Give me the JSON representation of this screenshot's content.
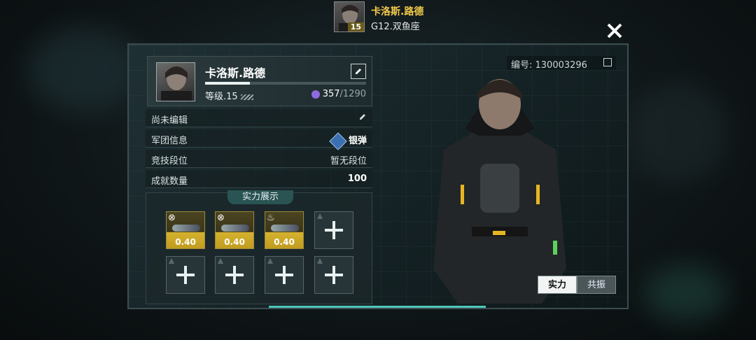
{
  "top": {
    "name": "卡洛斯.路德",
    "level": "15",
    "subtitle": "G12.双鱼座"
  },
  "close_icon": "close-icon",
  "profile": {
    "name": "卡洛斯.路德",
    "level_label": "等级.15",
    "xp_current": "357",
    "xp_max": "/1290",
    "xp_progress": 0.28,
    "id_label": "编号: 130003296"
  },
  "rows": [
    {
      "label": "尚未编辑",
      "value": ""
    },
    {
      "label": "军团信息",
      "value": "银弹"
    },
    {
      "label": "竞技段位",
      "value": "暂无段位"
    },
    {
      "label": "成就数量",
      "value": "100"
    }
  ],
  "showcase": {
    "title": "实力展示",
    "slots": [
      {
        "filled": true,
        "value": "0.40",
        "icon": "crosshair-icon"
      },
      {
        "filled": true,
        "value": "0.40",
        "icon": "crosshair-icon"
      },
      {
        "filled": true,
        "value": "0.40",
        "icon": "flame-icon"
      },
      {
        "filled": false
      },
      {
        "filled": false
      },
      {
        "filled": false
      },
      {
        "filled": false
      },
      {
        "filled": false
      }
    ]
  },
  "tabs": [
    {
      "label": "实力",
      "active": true
    },
    {
      "label": "共振",
      "active": false
    }
  ],
  "colors": {
    "accent": "#4fc6b7",
    "gold": "#f2c94c",
    "slot_gold": "#d4b22e"
  }
}
